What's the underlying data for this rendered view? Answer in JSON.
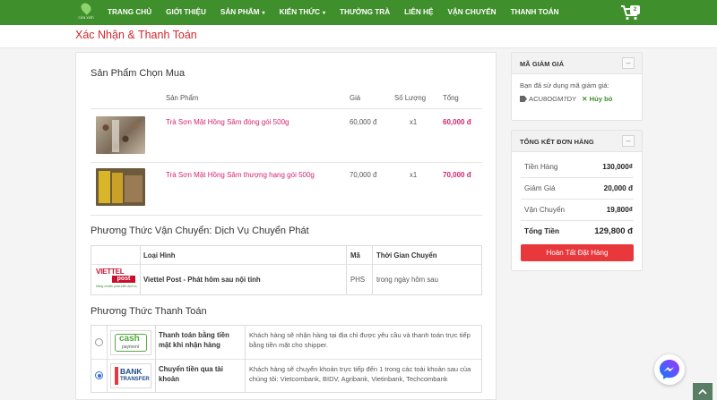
{
  "brand": {
    "logo_text": "cửa xinh"
  },
  "nav": {
    "items": [
      {
        "label": "TRANG CHỦ",
        "dropdown": false
      },
      {
        "label": "GIỚI THIỆU",
        "dropdown": false
      },
      {
        "label": "SẢN PHẨM",
        "dropdown": true
      },
      {
        "label": "KIẾN THỨC",
        "dropdown": true
      },
      {
        "label": "THƯỞNG TRÀ",
        "dropdown": false
      },
      {
        "label": "LIÊN HỆ",
        "dropdown": false
      },
      {
        "label": "VẬN CHUYỂN",
        "dropdown": false
      },
      {
        "label": "THANH TOÁN",
        "dropdown": false
      }
    ],
    "cart_count": "2",
    "caret": "▾"
  },
  "page": {
    "title": "Xác Nhận & Thanh Toán"
  },
  "products": {
    "title": "Sản Phẩm Chọn Mua",
    "headers": {
      "name": "Sản Phẩm",
      "price": "Giá",
      "qty": "Số Lượng",
      "total": "Tổng"
    },
    "rows": [
      {
        "name": "Trà Sơn Mật Hồng Sâm đóng gói 500g",
        "price": "60,000 đ",
        "qty": "x1",
        "total": "60,000 đ"
      },
      {
        "name": "Trà Sơn Mật Hồng Sâm thượng hạng gói 500g",
        "price": "70,000 đ",
        "qty": "x1",
        "total": "70,000 đ"
      }
    ]
  },
  "shipping": {
    "title": "Phương Thức Vận Chuyển: Dịch Vụ Chuyển Phát",
    "headers": {
      "type": "Loại Hình",
      "code": "Mã",
      "time": "Thời Gian Chuyển"
    },
    "row": {
      "logo_top": "VIETTEL",
      "logo_bottom": "post",
      "logo_tag": "Nâng chuẩn phát triển dịch vụ",
      "type": "Viettel Post - Phát hôm sau nội tỉnh",
      "code": "PHS",
      "time": "trong ngày hôm sau"
    }
  },
  "payment": {
    "title": "Phương Thức Thanh Toán",
    "methods": [
      {
        "logo_top": "cash",
        "logo_bottom": "payment",
        "name": "Thanh toán bằng tiền mặt khi nhận hàng",
        "desc": "Khách hàng sẽ nhận hàng tại địa chỉ được yêu cầu và thanh toán trực tiếp bằng tiền mặt cho shipper.",
        "selected": false
      },
      {
        "logo_top": "BANK",
        "logo_bottom": "TRANSFER",
        "name": "Chuyển tiền qua tài khoản",
        "desc": "Khách hàng sẽ chuyển khoản trực tiếp đến 1 trong các toài khoản sau của chúng tôi: Vietcombank, BIDV, Agribank, Vietinbank, Techcombank",
        "selected": true
      }
    ]
  },
  "coupon": {
    "title": "MÃ GIẢM GIÁ",
    "collapse": "–",
    "message": "Bạn đã sử dụng mã giảm giá:",
    "code": "ACU8OGM7DY",
    "cancel": "Hủy bỏ"
  },
  "summary": {
    "title": "TỔNG KẾT ĐƠN HÀNG",
    "collapse": "–",
    "rows": [
      {
        "label": "Tiền Hàng",
        "value": "130,000₫"
      },
      {
        "label": "Giảm Giá",
        "value": "20,000 đ"
      },
      {
        "label": "Vận Chuyển",
        "value": "19,800₫"
      },
      {
        "label": "Tổng Tiền",
        "value": "129,800 đ"
      }
    ],
    "button": "Hoàn Tất Đặt Hàng"
  },
  "colors": {
    "nav_green": "#3f8f2c",
    "accent_red": "#d4272d",
    "price_pink": "#d6246e",
    "button_red": "#e8383c",
    "radio_blue": "#3370d6"
  }
}
